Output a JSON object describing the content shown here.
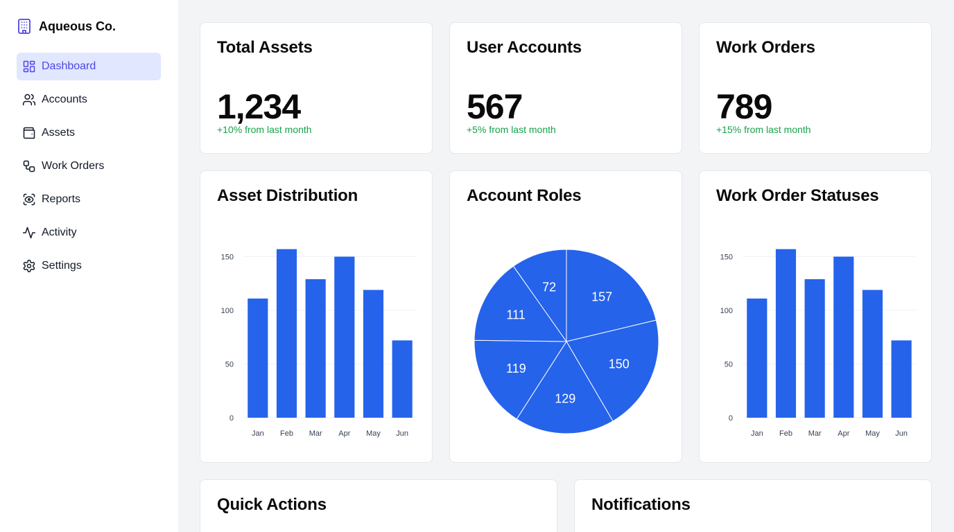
{
  "brand": {
    "name": "Aqueous Co.",
    "icon": "building-icon",
    "icon_color": "#4f46e5"
  },
  "sidebar": {
    "items": [
      {
        "label": "Dashboard",
        "icon": "dashboard-icon",
        "active": true
      },
      {
        "label": "Accounts",
        "icon": "users-icon",
        "active": false
      },
      {
        "label": "Assets",
        "icon": "wallet-icon",
        "active": false
      },
      {
        "label": "Work Orders",
        "icon": "workflow-icon",
        "active": false
      },
      {
        "label": "Reports",
        "icon": "eye-icon",
        "active": false
      },
      {
        "label": "Activity",
        "icon": "activity-icon",
        "active": false
      },
      {
        "label": "Settings",
        "icon": "gear-icon",
        "active": false
      }
    ]
  },
  "stats": [
    {
      "title": "Total Assets",
      "value": "1,234",
      "change": "+10% from last month"
    },
    {
      "title": "User Accounts",
      "value": "567",
      "change": "+5% from last month"
    },
    {
      "title": "Work Orders",
      "value": "789",
      "change": "+15% from last month"
    }
  ],
  "colors": {
    "accent": "#2563eb",
    "positive": "#16a34a",
    "nav_active_bg": "#e0e7ff",
    "nav_active_text": "#4f46e5"
  },
  "charts": {
    "asset_distribution": {
      "title": "Asset Distribution"
    },
    "account_roles": {
      "title": "Account Roles"
    },
    "work_order_statuses": {
      "title": "Work Order Statuses"
    }
  },
  "chart_data": [
    {
      "type": "bar",
      "title": "Asset Distribution",
      "categories": [
        "Jan",
        "Feb",
        "Mar",
        "Apr",
        "May",
        "Jun"
      ],
      "values": [
        111,
        157,
        129,
        150,
        119,
        72
      ],
      "yticks": [
        0,
        50,
        100,
        150
      ],
      "ylim": [
        0,
        160
      ],
      "grid": true,
      "color": "#2563eb"
    },
    {
      "type": "pie",
      "title": "Account Roles",
      "values": [
        157,
        150,
        129,
        119,
        111,
        72
      ],
      "color": "#2563eb"
    },
    {
      "type": "bar",
      "title": "Work Order Statuses",
      "categories": [
        "Jan",
        "Feb",
        "Mar",
        "Apr",
        "May",
        "Jun"
      ],
      "values": [
        111,
        157,
        129,
        150,
        119,
        72
      ],
      "yticks": [
        0,
        50,
        100,
        150
      ],
      "ylim": [
        0,
        160
      ],
      "grid": true,
      "color": "#2563eb"
    }
  ],
  "bottom": {
    "quick_actions": {
      "title": "Quick Actions"
    },
    "notifications": {
      "title": "Notifications"
    }
  }
}
